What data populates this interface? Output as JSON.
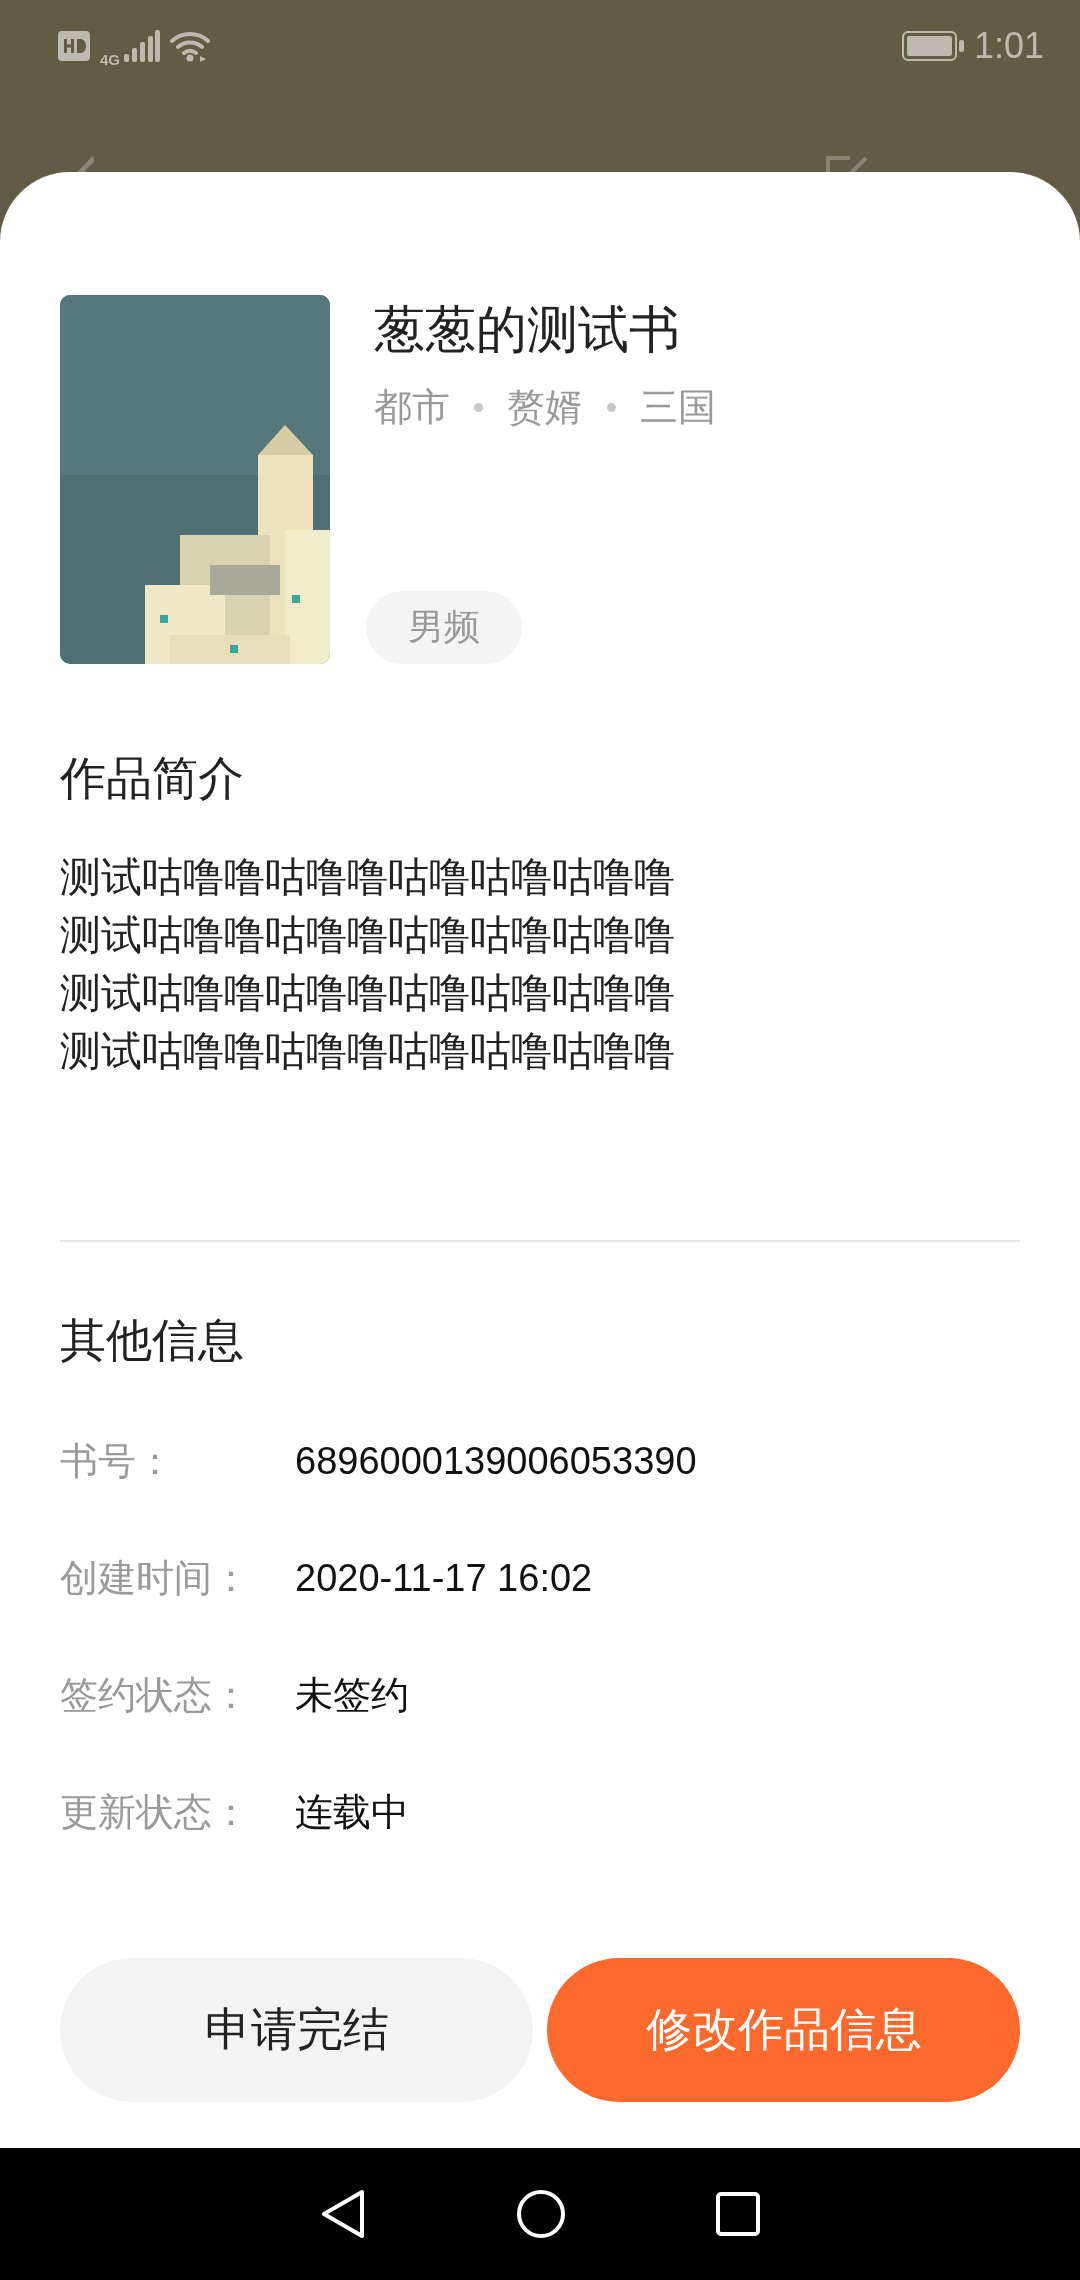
{
  "status_bar": {
    "time": "1:01",
    "network": "4G"
  },
  "book": {
    "cover": {
      "kind": "picture"
    },
    "title": "葱葱的测试书",
    "tags": [
      "都市",
      "赘婿",
      "三国"
    ],
    "channel": "男频"
  },
  "intro": {
    "heading": "作品简介",
    "lines": [
      "测试咕噜噜咕噜噜咕噜咕噜咕噜噜",
      "测试咕噜噜咕噜噜咕噜咕噜咕噜噜",
      "测试咕噜噜咕噜噜咕噜咕噜咕噜噜",
      "测试咕噜噜咕噜噜咕噜咕噜咕噜噜"
    ]
  },
  "other_info": {
    "heading": "其他信息",
    "rows": [
      {
        "label": "书号：",
        "value": "6896000139006053390"
      },
      {
        "label": "创建时间：",
        "value": "2020-11-17 16:02"
      },
      {
        "label": "签约状态：",
        "value": "未签约"
      },
      {
        "label": "更新状态：",
        "value": "连载中"
      }
    ]
  },
  "buttons": [
    {
      "label": "申请完结",
      "kind": "secondary"
    },
    {
      "label": "修改作品信息",
      "kind": "primary"
    }
  ]
}
